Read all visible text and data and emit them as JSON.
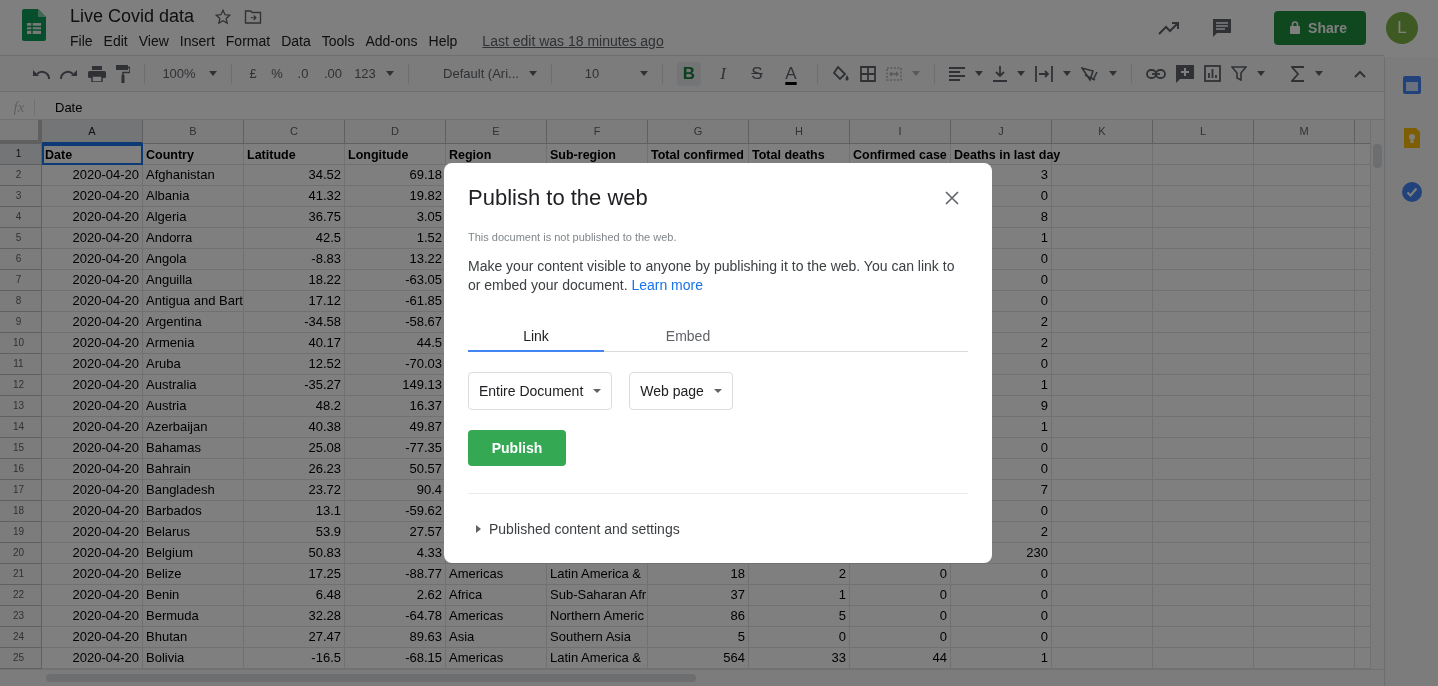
{
  "document": {
    "title": "Live Covid data",
    "menu": [
      "File",
      "Edit",
      "View",
      "Insert",
      "Format",
      "Data",
      "Tools",
      "Add-ons",
      "Help"
    ],
    "last_edit": "Last edit was 18 minutes ago",
    "share": "Share",
    "avatar": "L"
  },
  "toolbar": {
    "zoom": "100%",
    "currency": "£",
    "percent": "%",
    "decimal_decrease": ".0",
    "decimal_increase": ".00",
    "number_format": "123",
    "font": "Default (Ari...",
    "font_size": "10",
    "bold": {
      "label": "B",
      "on": true
    },
    "italic": {
      "label": "I",
      "on": false
    },
    "strikethrough": {
      "label": "S",
      "on": false
    },
    "text_color": {
      "label": "A"
    }
  },
  "formula_bar": {
    "label": "fx",
    "value": "Date"
  },
  "sheet": {
    "columns": [
      {
        "letter": "A",
        "kind": "number",
        "selected": true
      },
      {
        "letter": "B",
        "kind": "text",
        "selected": false
      },
      {
        "letter": "C",
        "kind": "number",
        "selected": false
      },
      {
        "letter": "D",
        "kind": "number",
        "selected": false
      },
      {
        "letter": "E",
        "kind": "text",
        "selected": false
      },
      {
        "letter": "F",
        "kind": "text",
        "selected": false
      },
      {
        "letter": "G",
        "kind": "number",
        "selected": false
      },
      {
        "letter": "H",
        "kind": "number",
        "selected": false
      },
      {
        "letter": "I",
        "kind": "number",
        "selected": false
      },
      {
        "letter": "J",
        "kind": "number",
        "selected": false
      },
      {
        "letter": "K",
        "kind": "text",
        "selected": false
      },
      {
        "letter": "L",
        "kind": "text",
        "selected": false
      },
      {
        "letter": "M",
        "kind": "text",
        "selected": false
      }
    ],
    "rows": [
      {
        "number": "1",
        "kind": "header",
        "selected": true,
        "cells": {
          "A": "Date",
          "B": "Country",
          "C": "Latitude",
          "D": "Longitude",
          "E": "Region",
          "F": "Sub-region",
          "G": "Total confirmed",
          "H": "Total deaths",
          "I": "Confirmed case",
          "J": "Deaths in last day"
        }
      },
      {
        "number": "2",
        "kind": "data",
        "selected": false,
        "cells": {
          "A": "2020-04-20",
          "B": "Afghanistan",
          "C": "34.52",
          "D": "69.18",
          "J": "3"
        }
      },
      {
        "number": "3",
        "kind": "data",
        "selected": false,
        "cells": {
          "A": "2020-04-20",
          "B": "Albania",
          "C": "41.32",
          "D": "19.82",
          "J": "0"
        }
      },
      {
        "number": "4",
        "kind": "data",
        "selected": false,
        "cells": {
          "A": "2020-04-20",
          "B": "Algeria",
          "C": "36.75",
          "D": "3.05",
          "J": "8"
        }
      },
      {
        "number": "5",
        "kind": "data",
        "selected": false,
        "cells": {
          "A": "2020-04-20",
          "B": "Andorra",
          "C": "42.5",
          "D": "1.52",
          "J": "1"
        }
      },
      {
        "number": "6",
        "kind": "data",
        "selected": false,
        "cells": {
          "A": "2020-04-20",
          "B": "Angola",
          "C": "-8.83",
          "D": "13.22",
          "J": "0"
        }
      },
      {
        "number": "7",
        "kind": "data",
        "selected": false,
        "cells": {
          "A": "2020-04-20",
          "B": "Anguilla",
          "C": "18.22",
          "D": "-63.05",
          "J": "0"
        }
      },
      {
        "number": "8",
        "kind": "data",
        "selected": false,
        "cells": {
          "A": "2020-04-20",
          "B": "Antigua and Bart",
          "C": "17.12",
          "D": "-61.85",
          "J": "0"
        }
      },
      {
        "number": "9",
        "kind": "data",
        "selected": false,
        "cells": {
          "A": "2020-04-20",
          "B": "Argentina",
          "C": "-34.58",
          "D": "-58.67",
          "J": "2"
        }
      },
      {
        "number": "10",
        "kind": "data",
        "selected": false,
        "cells": {
          "A": "2020-04-20",
          "B": "Armenia",
          "C": "40.17",
          "D": "44.5",
          "J": "2"
        }
      },
      {
        "number": "11",
        "kind": "data",
        "selected": false,
        "cells": {
          "A": "2020-04-20",
          "B": "Aruba",
          "C": "12.52",
          "D": "-70.03",
          "J": "0"
        }
      },
      {
        "number": "12",
        "kind": "data",
        "selected": false,
        "cells": {
          "A": "2020-04-20",
          "B": "Australia",
          "C": "-35.27",
          "D": "149.13",
          "J": "1"
        }
      },
      {
        "number": "13",
        "kind": "data",
        "selected": false,
        "cells": {
          "A": "2020-04-20",
          "B": "Austria",
          "C": "48.2",
          "D": "16.37",
          "J": "9"
        }
      },
      {
        "number": "14",
        "kind": "data",
        "selected": false,
        "cells": {
          "A": "2020-04-20",
          "B": "Azerbaijan",
          "C": "40.38",
          "D": "49.87",
          "J": "1"
        }
      },
      {
        "number": "15",
        "kind": "data",
        "selected": false,
        "cells": {
          "A": "2020-04-20",
          "B": "Bahamas",
          "C": "25.08",
          "D": "-77.35",
          "J": "0"
        }
      },
      {
        "number": "16",
        "kind": "data",
        "selected": false,
        "cells": {
          "A": "2020-04-20",
          "B": "Bahrain",
          "C": "26.23",
          "D": "50.57",
          "J": "0"
        }
      },
      {
        "number": "17",
        "kind": "data",
        "selected": false,
        "cells": {
          "A": "2020-04-20",
          "B": "Bangladesh",
          "C": "23.72",
          "D": "90.4",
          "J": "7"
        }
      },
      {
        "number": "18",
        "kind": "data",
        "selected": false,
        "cells": {
          "A": "2020-04-20",
          "B": "Barbados",
          "C": "13.1",
          "D": "-59.62",
          "J": "0"
        }
      },
      {
        "number": "19",
        "kind": "data",
        "selected": false,
        "cells": {
          "A": "2020-04-20",
          "B": "Belarus",
          "C": "53.9",
          "D": "27.57",
          "J": "2"
        }
      },
      {
        "number": "20",
        "kind": "data",
        "selected": false,
        "cells": {
          "A": "2020-04-20",
          "B": "Belgium",
          "C": "50.83",
          "D": "4.33",
          "J": "230"
        }
      },
      {
        "number": "21",
        "kind": "data",
        "selected": false,
        "cells": {
          "A": "2020-04-20",
          "B": "Belize",
          "C": "17.25",
          "D": "-88.77",
          "E": "Americas",
          "F": "Latin America &",
          "G": "18",
          "H": "2",
          "I": "0",
          "J": "0"
        }
      },
      {
        "number": "22",
        "kind": "data",
        "selected": false,
        "cells": {
          "A": "2020-04-20",
          "B": "Benin",
          "C": "6.48",
          "D": "2.62",
          "E": "Africa",
          "F": "Sub-Saharan Afr",
          "G": "37",
          "H": "1",
          "I": "0",
          "J": "0"
        }
      },
      {
        "number": "23",
        "kind": "data",
        "selected": false,
        "cells": {
          "A": "2020-04-20",
          "B": "Bermuda",
          "C": "32.28",
          "D": "-64.78",
          "E": "Americas",
          "F": "Northern Americ",
          "G": "86",
          "H": "5",
          "I": "0",
          "J": "0"
        }
      },
      {
        "number": "24",
        "kind": "data",
        "selected": false,
        "cells": {
          "A": "2020-04-20",
          "B": "Bhutan",
          "C": "27.47",
          "D": "89.63",
          "E": "Asia",
          "F": "Southern Asia",
          "G": "5",
          "H": "0",
          "I": "0",
          "J": "0"
        }
      },
      {
        "number": "25",
        "kind": "data",
        "selected": false,
        "cells": {
          "A": "2020-04-20",
          "B": "Bolivia",
          "C": "-16.5",
          "D": "-68.15",
          "E": "Americas",
          "F": "Latin America &",
          "G": "564",
          "H": "33",
          "I": "44",
          "J": "1"
        }
      }
    ]
  },
  "dialog": {
    "title": "Publish to the web",
    "status": "This document is not published to the web.",
    "description": "Make your content visible to anyone by publishing it to the web. You can link to or embed your document.",
    "learn_more": "Learn more",
    "tabs": [
      {
        "label": "Link",
        "selected": true
      },
      {
        "label": "Embed",
        "selected": false
      }
    ],
    "dropdowns": [
      "Entire Document",
      "Web page"
    ],
    "publish": "Publish",
    "published_settings": {
      "label": "Published content and settings",
      "expanded": false
    }
  }
}
